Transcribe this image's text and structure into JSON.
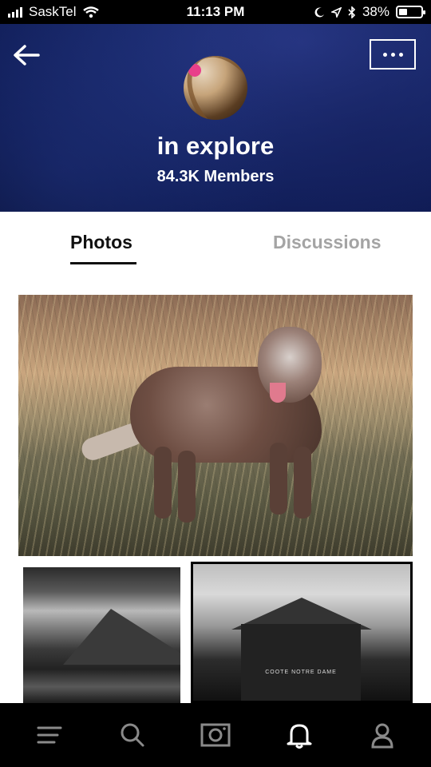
{
  "status_bar": {
    "carrier": "SaskTel",
    "time": "11:13 PM",
    "battery": "38%",
    "battery_level": 0.38
  },
  "group": {
    "name": "in explore",
    "members": "84.3K Members"
  },
  "tabs": [
    {
      "label": "Photos",
      "active": true
    },
    {
      "label": "Discussions",
      "active": false
    }
  ],
  "photos": [
    {
      "subject": "merle dog standing in golden grass field"
    },
    {
      "subject": "black and white mountain with stream"
    },
    {
      "subject": "black and white church building with Jupiter signs"
    }
  ],
  "photo_right_sign": "COOTE NOTRE DAME",
  "bottom_nav": [
    {
      "icon": "menu-icon"
    },
    {
      "icon": "search-icon"
    },
    {
      "icon": "camera-icon"
    },
    {
      "icon": "bell-icon",
      "active": true
    },
    {
      "icon": "profile-icon"
    }
  ],
  "colors": {
    "header_bg": "#13215c",
    "tab_active": "#111111",
    "tab_inactive": "#a4a4a4",
    "nav_bg": "#000000",
    "nav_icon": "#8a8a8a",
    "nav_icon_active": "#ffffff"
  }
}
